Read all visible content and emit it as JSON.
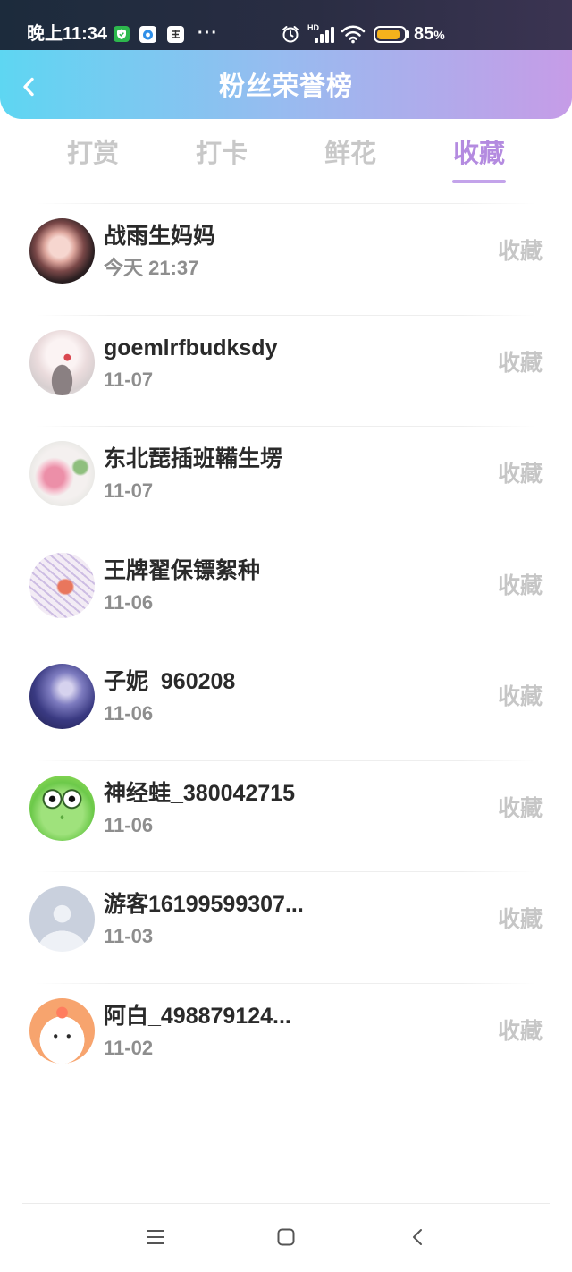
{
  "status_bar": {
    "time": "晚上11:34",
    "notification_icons": [
      "shield-icon",
      "app-icon",
      "app-icon"
    ],
    "more": "···",
    "alarm_icon": "alarm-clock-icon",
    "signal_label": "HD",
    "signal_icon": "cellular-signal-icon",
    "wifi_icon": "wifi-icon",
    "battery_icon": "battery-icon",
    "battery_level": 0.85,
    "battery_value": "85",
    "battery_unit": "%"
  },
  "header": {
    "back_icon": "chevron-left-icon",
    "title": "粉丝荣誉榜"
  },
  "tabs": [
    {
      "label": "打赏",
      "active": false
    },
    {
      "label": "打卡",
      "active": false
    },
    {
      "label": "鲜花",
      "active": false
    },
    {
      "label": "收藏",
      "active": true
    }
  ],
  "list": {
    "items": [
      {
        "name": "战雨生妈妈",
        "time": "今天 21:37",
        "action": "收藏"
      },
      {
        "name": "goemlrfbudksdy",
        "time": "11-07",
        "action": "收藏"
      },
      {
        "name": "东北琵插班鞴生塄",
        "time": "11-07",
        "action": "收藏"
      },
      {
        "name": "王牌翟保镖絮种",
        "time": "11-06",
        "action": "收藏"
      },
      {
        "name": "子妮_960208",
        "time": "11-06",
        "action": "收藏"
      },
      {
        "name": "神经蛙_380042715",
        "time": "11-06",
        "action": "收藏"
      },
      {
        "name": "游客16199599307...",
        "time": "11-03",
        "action": "收藏"
      },
      {
        "name": "阿白_498879124...",
        "time": "11-02",
        "action": "收藏"
      }
    ]
  },
  "nav_bar": {
    "icons": [
      "menu-icon",
      "home-square-icon",
      "back-chevron-icon"
    ]
  },
  "colors": {
    "header_gradient_start": "#5ed6f2",
    "header_gradient_end": "#c69ce7",
    "tab_active": "#b48be0",
    "tab_inactive": "#c8c8c8",
    "battery_fill": "#f5b21c"
  }
}
